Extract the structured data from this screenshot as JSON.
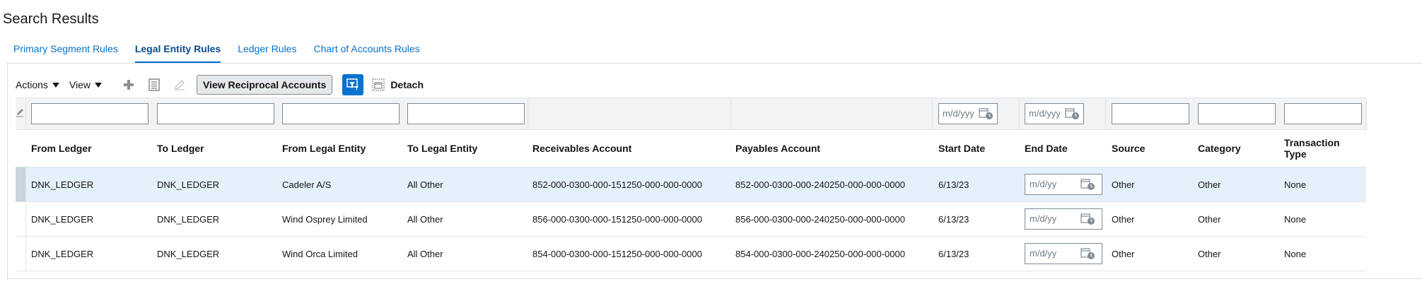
{
  "page_title": "Search Results",
  "tabs": [
    {
      "label": "Primary Segment Rules",
      "active": false
    },
    {
      "label": "Legal Entity Rules",
      "active": true
    },
    {
      "label": "Ledger Rules",
      "active": false
    },
    {
      "label": "Chart of Accounts Rules",
      "active": false
    }
  ],
  "toolbar": {
    "actions_label": "Actions",
    "view_label": "View",
    "add_icon": "plus-icon",
    "export_icon": "export-icon",
    "edit_icon": "pencil-icon",
    "reciprocal_label": "View Reciprocal Accounts",
    "qbe_icon": "query-by-example-icon",
    "detach_label": "Detach"
  },
  "filters": {
    "date_placeholder": "m/d/yyy"
  },
  "columns": [
    "From Ledger",
    "To Ledger",
    "From Legal Entity",
    "To Legal Entity",
    "Receivables Account",
    "Payables Account",
    "Start Date",
    "End Date",
    "Source",
    "Category",
    "Transaction Type"
  ],
  "end_date_placeholder": "m/d/yy",
  "rows": [
    {
      "from_ledger": "DNK_LEDGER",
      "to_ledger": "DNK_LEDGER",
      "from_le": "Cadeler A/S",
      "to_le": "All Other",
      "receivables": "852-000-0300-000-151250-000-000-0000",
      "payables": "852-000-0300-000-240250-000-000-0000",
      "start_date": "6/13/23",
      "source": "Other",
      "category": "Other",
      "txn_type": "None",
      "selected": true
    },
    {
      "from_ledger": "DNK_LEDGER",
      "to_ledger": "DNK_LEDGER",
      "from_le": "Wind Osprey Limited",
      "to_le": "All Other",
      "receivables": "856-000-0300-000-151250-000-000-0000",
      "payables": "856-000-0300-000-240250-000-000-0000",
      "start_date": "6/13/23",
      "source": "Other",
      "category": "Other",
      "txn_type": "None",
      "selected": false
    },
    {
      "from_ledger": "DNK_LEDGER",
      "to_ledger": "DNK_LEDGER",
      "from_le": "Wind Orca Limited",
      "to_le": "All Other",
      "receivables": "854-000-0300-000-151250-000-000-0000",
      "payables": "854-000-0300-000-240250-000-000-0000",
      "start_date": "6/13/23",
      "source": "Other",
      "category": "Other",
      "txn_type": "None",
      "selected": false
    }
  ],
  "colors": {
    "accent": "#0572ce",
    "selected_row": "#e4f1fb",
    "filter_bg": "#f1f3f4"
  }
}
